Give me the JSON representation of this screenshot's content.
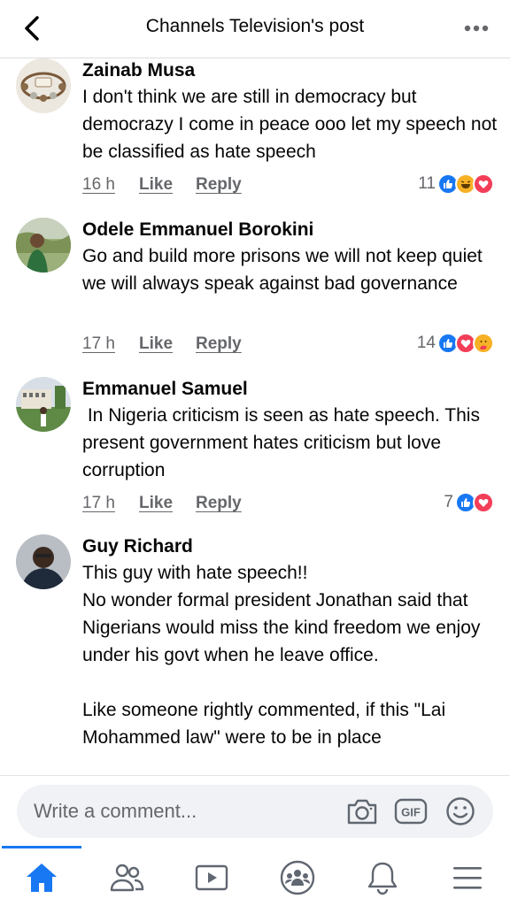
{
  "header": {
    "title": "Channels Television's post",
    "back_icon": "chevron-left-icon",
    "more_icon": "more-dots-icon"
  },
  "comments": [
    {
      "name": "Zainab Musa",
      "text": "I don't think we are still in democracy but democrazy I come in peace ooo let my speech not be classified as hate speech",
      "time": "16 h",
      "like": "Like",
      "reply": "Reply",
      "reaction_count": "11",
      "reactions": [
        "like",
        "haha",
        "love"
      ]
    },
    {
      "name": "Odele Emmanuel Borokini",
      "text": "Go and build more prisons we will not keep quiet we will always speak against bad governance",
      "time": "17 h",
      "like": "Like",
      "reply": "Reply",
      "reaction_count": "14",
      "reactions": [
        "like",
        "love",
        "care"
      ]
    },
    {
      "name": "Emmanuel Samuel",
      "text": " In Nigeria criticism is seen as hate speech. This present government hates criticism but love corruption",
      "time": "17 h",
      "like": "Like",
      "reply": "Reply",
      "reaction_count": "7",
      "reactions": [
        "like",
        "love"
      ]
    },
    {
      "name": "Guy Richard",
      "text": "This guy with hate speech!!\nNo wonder formal president Jonathan said that Nigerians would miss the kind freedom we enjoy under his govt when he leave office.\n\nLike someone rightly commented, if this \"Lai Mohammed law\" were to be in place"
    }
  ],
  "composer": {
    "placeholder": "Write a comment...",
    "icons": [
      "camera-icon",
      "gif-icon",
      "emoji-icon"
    ]
  },
  "bottom_nav": {
    "items": [
      "home-icon",
      "friends-icon",
      "watch-icon",
      "groups-icon",
      "notifications-icon",
      "menu-icon"
    ],
    "active": "home-icon"
  },
  "colors": {
    "accent": "#1877f2",
    "love": "#f33e58",
    "haha": "#f7b125",
    "secondary_text": "#65676b"
  }
}
